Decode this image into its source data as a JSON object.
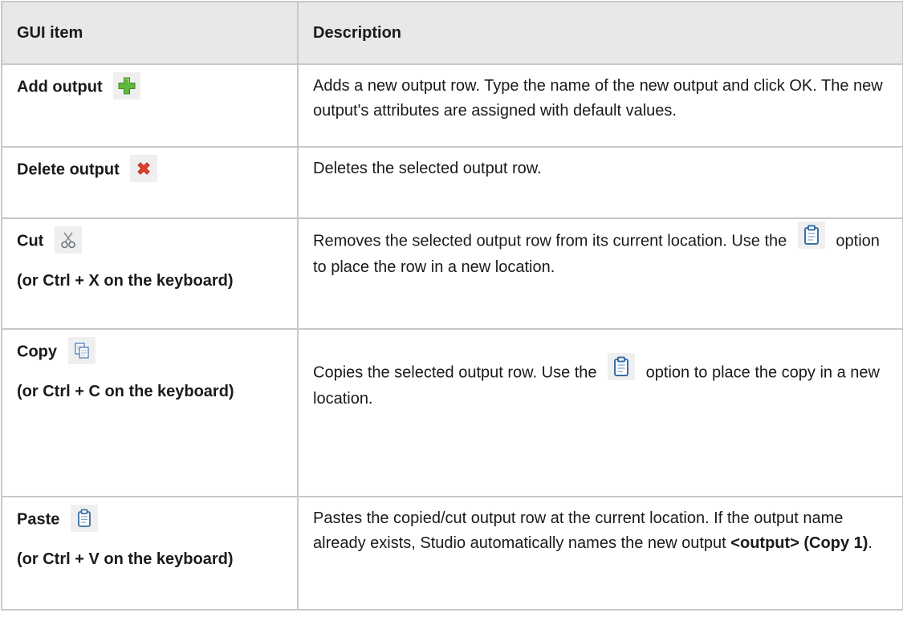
{
  "table": {
    "headers": {
      "gui_item": "GUI item",
      "description": "Description"
    },
    "rows": [
      {
        "item": "Add output",
        "icon": "plus-icon",
        "description": "Adds a new output row. Type the name of the new output and click OK. The new output's attributes are assigned with default values."
      },
      {
        "item": "Delete output",
        "icon": "delete-x-icon",
        "description": "Deletes the selected output row."
      },
      {
        "item": "Cut",
        "icon": "scissors-icon",
        "shortcut": "(or Ctrl + X on the keyboard)",
        "description_before_icon": "Removes the selected output row from its current location. Use the",
        "inline_icon": "clipboard-icon",
        "description_after_icon": "option to place the row in a new location."
      },
      {
        "item": "Copy",
        "icon": "copy-icon",
        "shortcut": "(or Ctrl + C on the keyboard)",
        "description_before_icon": "Copies the selected output row. Use the",
        "inline_icon": "clipboard-icon",
        "description_after_icon": "option to place the copy in a new location."
      },
      {
        "item": "Paste",
        "icon": "clipboard-icon",
        "shortcut": "(or Ctrl + V on the keyboard)",
        "description": "Pastes the copied/cut output row at the current location. If the output name already exists, Studio automatically names the new output",
        "description_bold": "<output> (Copy 1)",
        "description_end": "."
      }
    ]
  }
}
